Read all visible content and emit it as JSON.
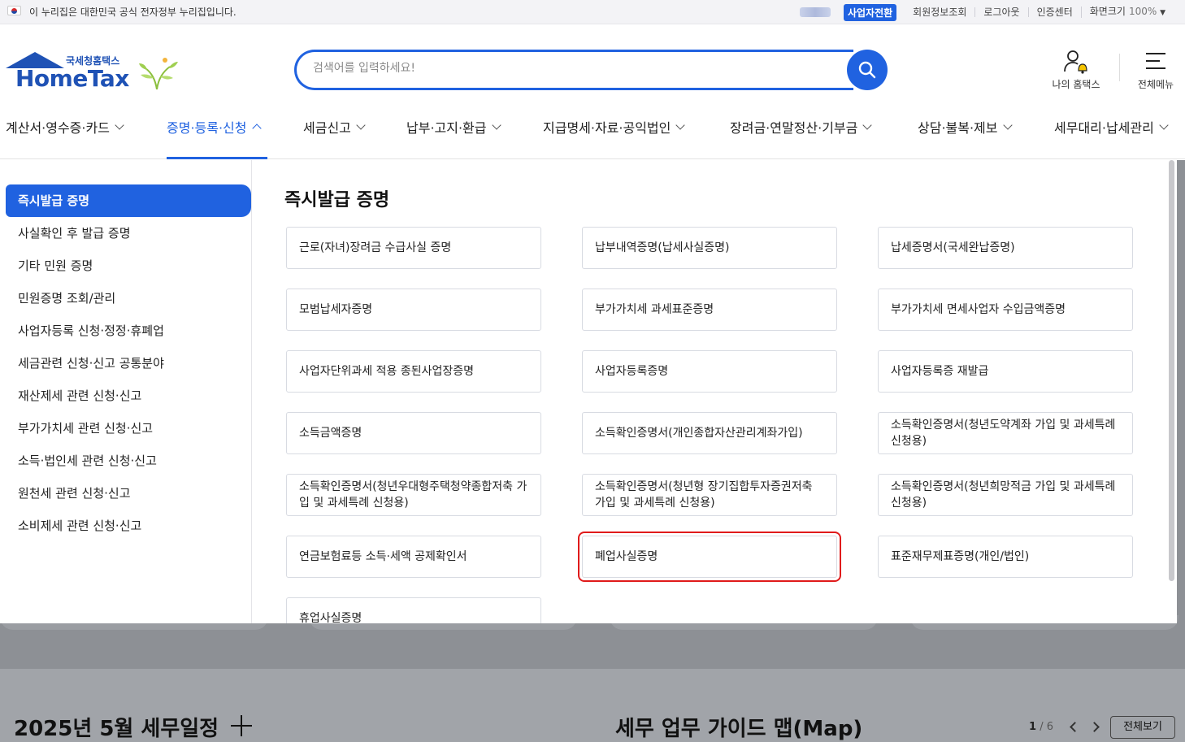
{
  "gov_banner": {
    "text": "이 누리집은 대한민국 공식 전자정부 누리집입니다.",
    "biz_switch": "사업자전환",
    "links": [
      "회원정보조회",
      "로그아웃",
      "인증센터"
    ],
    "zoom_label": "화면크기",
    "zoom_value": "100%"
  },
  "logo": {
    "small": "국세청홈택스",
    "main": "HomeTax"
  },
  "search": {
    "placeholder": "검색어를 입력하세요!"
  },
  "util": {
    "my_hometax": "나의 홈택스",
    "all_menu": "전체메뉴"
  },
  "gnb": [
    "계산서·영수증·카드",
    "증명·등록·신청",
    "세금신고",
    "납부·고지·환급",
    "지급명세·자료·공익법인",
    "장려금·연말정산·기부금",
    "상담·불복·제보",
    "세무대리·납세관리"
  ],
  "side_menu": {
    "active": "즉시발급 증명",
    "items": [
      "사실확인 후 발급 증명",
      "기타 민원 증명",
      "민원증명 조회/관리",
      "사업자등록 신청·정정·휴폐업",
      "세금관련 신청·신고 공통분야",
      "재산제세 관련 신청·신고",
      "부가가치세 관련 신청·신고",
      "소득·법인세 관련 신청·신고",
      "원천세 관련 신청·신고",
      "소비제세 관련 신청·신고"
    ]
  },
  "content": {
    "title": "즉시발급 증명",
    "items": [
      "근로(자녀)장려금 수급사실 증명",
      "납부내역증명(납세사실증명)",
      "납세증명서(국세완납증명)",
      "모범납세자증명",
      "부가가치세 과세표준증명",
      "부가가치세 면세사업자 수입금액증명",
      "사업자단위과세 적용 종된사업장증명",
      "사업자등록증명",
      "사업자등록증 재발급",
      "소득금액증명",
      "소득확인증명서(개인종합자산관리계좌가입)",
      "소득확인증명서(청년도약계좌 가입 및 과세특례 신청용)",
      "소득확인증명서(청년우대형주택청약종합저축 가입 및 과세특례 신청용)",
      "소득확인증명서(청년형 장기집합투자증권저축 가입 및 과세특례 신청용)",
      "소득확인증명서(청년희망적금 가입 및 과세특례 신청용)",
      "연금보험료등 소득·세액 공제확인서",
      "폐업사실증명",
      "표준재무제표증명(개인/법인)",
      "휴업사실증명"
    ],
    "highlighted": "폐업사실증명"
  },
  "background": {
    "schedule_title": "2025년 5월 세무일정",
    "guide_title": "세무 업무 가이드 맵(Map)",
    "pager_current": "1",
    "pager_total": "6",
    "view_all": "전체보기"
  },
  "colors": {
    "accent": "#2062e0",
    "highlight": "#e01b1b"
  }
}
